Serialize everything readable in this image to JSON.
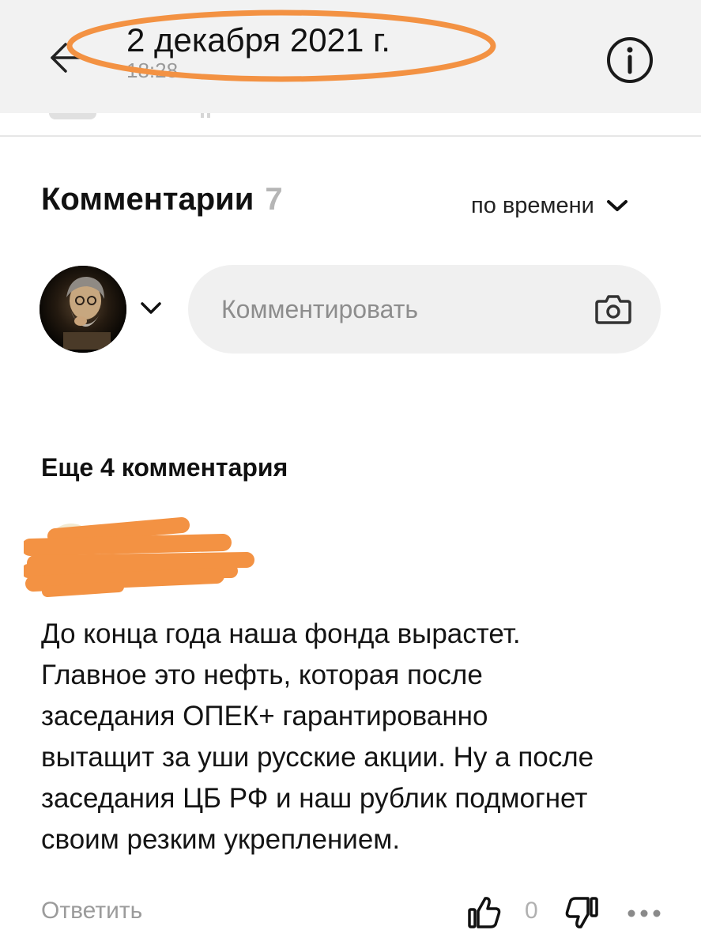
{
  "header": {
    "title": "2 декабря 2021 г.",
    "subtitle": "18:28",
    "highlight_color": "#f39243",
    "back_icon": "arrow-left-icon",
    "info_icon": "info-circle-icon"
  },
  "comments": {
    "title": "Комментарии",
    "count": "7",
    "sort_label": "по времени",
    "sort_icon": "chevron-down-icon"
  },
  "composer": {
    "placeholder": "Комментировать",
    "camera_icon": "camera-icon",
    "account_icon": "chevron-down-icon"
  },
  "thread": {
    "more_label": "Еще 4 комментария",
    "redaction_color": "#f39243",
    "comment": {
      "lines": [
        "До конца года наша фонда вырастет.",
        "Главное это нефть, которая после",
        "заседания ОПЕК+ гарантированно",
        "вытащит за уши русские акции. Ну а после",
        "заседания ЦБ РФ и наш рублик подмогнет",
        "своим резким укреплением."
      ],
      "reply_label": "Ответить",
      "votes": "0",
      "like_icon": "thumbs-up-icon",
      "dislike_icon": "thumbs-down-icon",
      "more_icon": "more-dots-icon"
    }
  }
}
